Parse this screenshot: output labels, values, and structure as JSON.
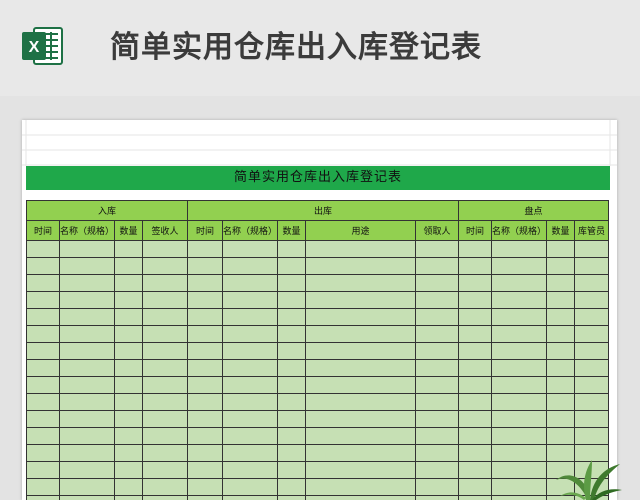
{
  "header": {
    "title": "简单实用仓库出入库登记表",
    "icon": "excel-icon",
    "accent": "#1fa84a"
  },
  "sheet": {
    "title": "简单实用仓库出入库登记表",
    "groups": [
      {
        "label": "入库",
        "span": 4
      },
      {
        "label": "出库",
        "span": 5
      },
      {
        "label": "盘点",
        "span": 4
      }
    ],
    "columns": [
      "时间",
      "名称（规格）",
      "数量",
      "签收人",
      "时间",
      "名称（规格）",
      "数量",
      "用途",
      "领取人",
      "时间",
      "名称（规格）",
      "数量",
      "库管员"
    ],
    "empty_rows": 16,
    "colors": {
      "header_fill": "#92d050",
      "body_fill": "#c6e0b4",
      "title_fill": "#1fa84a"
    }
  }
}
